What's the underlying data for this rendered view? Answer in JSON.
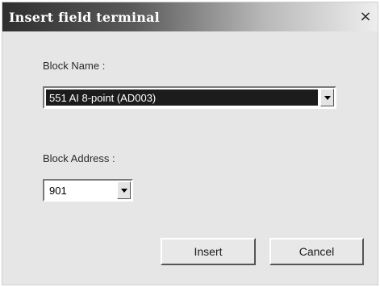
{
  "window": {
    "title": "Insert field terminal",
    "close_glyph": "×"
  },
  "form": {
    "block_name_label": "Block Name :",
    "block_name_value": "551  AI 8-point (AD003)",
    "block_address_label": "Block Address :",
    "block_address_value": "901"
  },
  "buttons": {
    "insert": "Insert",
    "cancel": "Cancel"
  },
  "icons": {
    "close": "close-icon",
    "dropdown": "chevron-down-icon"
  },
  "colors": {
    "selection_bg": "#1c1c1c",
    "dialog_bg": "#e6e6e6"
  }
}
